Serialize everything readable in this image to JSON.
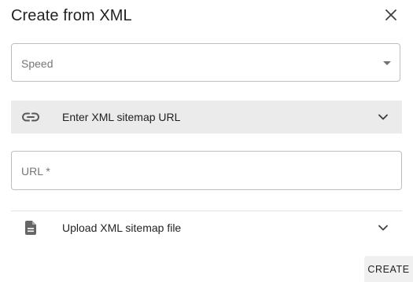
{
  "dialog": {
    "title": "Create from XML",
    "close_icon": "close-icon"
  },
  "speed_select": {
    "placeholder": "Speed",
    "icon": "caret-down-icon"
  },
  "url_section": {
    "label": "Enter XML sitemap URL",
    "icon": "link-icon",
    "expand_icon": "chevron-down-icon",
    "expanded": true,
    "field": {
      "placeholder": "URL *",
      "value": ""
    }
  },
  "file_section": {
    "label": "Upload XML sitemap file",
    "icon": "file-icon",
    "expand_icon": "chevron-down-icon",
    "expanded": false
  },
  "actions": {
    "create_label": "CREATE"
  },
  "colors": {
    "accordion_active_bg": "#ebebeb",
    "button_bg": "#f0f0f0",
    "border": "#bdbdbd",
    "text": "#212121"
  }
}
